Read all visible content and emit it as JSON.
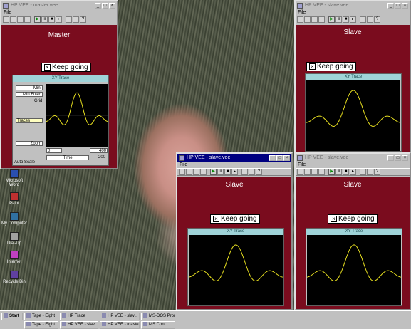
{
  "windows": {
    "master": {
      "title": "HP VEE - master.vee",
      "menu": "File",
      "panel_title": "Master",
      "keep_going": "Keep going",
      "graph_title": "XY Trace",
      "controls": [
        "Mini",
        "Min Fixed",
        "Grid",
        "Traces",
        "Zoom"
      ],
      "auto_scale": "Auto Scale",
      "scale_min": "0",
      "scale_max": "400",
      "x_label": "Time",
      "y_max": "200"
    },
    "slave_top": {
      "title": "HP VEE - slave.vee",
      "menu": "File",
      "panel_title": "Slave",
      "keep_going": "Keep going",
      "graph_title": "XY Trace"
    },
    "slave_mid": {
      "title": "HP VEE - slave.vee",
      "menu": "File",
      "panel_title": "Slave",
      "keep_going": "Keep going",
      "graph_title": "XY Trace"
    },
    "slave_right": {
      "title": "HP VEE - slave.vee",
      "menu": "File",
      "panel_title": "Slave",
      "keep_going": "Keep going",
      "graph_title": "XY Trace"
    }
  },
  "desktop_icons": [
    {
      "label": "Microsoft Word",
      "icon": "word-icon",
      "color": "#2a4fb0"
    },
    {
      "label": "Paint",
      "icon": "paint-icon",
      "color": "#c03030"
    },
    {
      "label": "My Computer",
      "icon": "computer-icon",
      "color": "#3070a0"
    },
    {
      "label": "Dial-Up",
      "icon": "network-icon",
      "color": "#a0a0a0"
    },
    {
      "label": "Internet",
      "icon": "internet-icon",
      "color": "#c040c0"
    },
    {
      "label": "Recycle Bin",
      "icon": "recycle-bin-icon",
      "color": "#6040a0"
    }
  ],
  "taskbar": {
    "start": "Start",
    "buttons": [
      "Tape - Eight",
      "Tape - Eight",
      "HP Trace",
      "HP VEE - slav...",
      "HP VEE - slav...",
      "HP VEE - maste...",
      "MS-DOS Prompt",
      "MS Con..."
    ]
  },
  "colors": {
    "panel": "#7a0c1e",
    "trace": "#e8e020",
    "graph_title": "#9fd3d8"
  }
}
